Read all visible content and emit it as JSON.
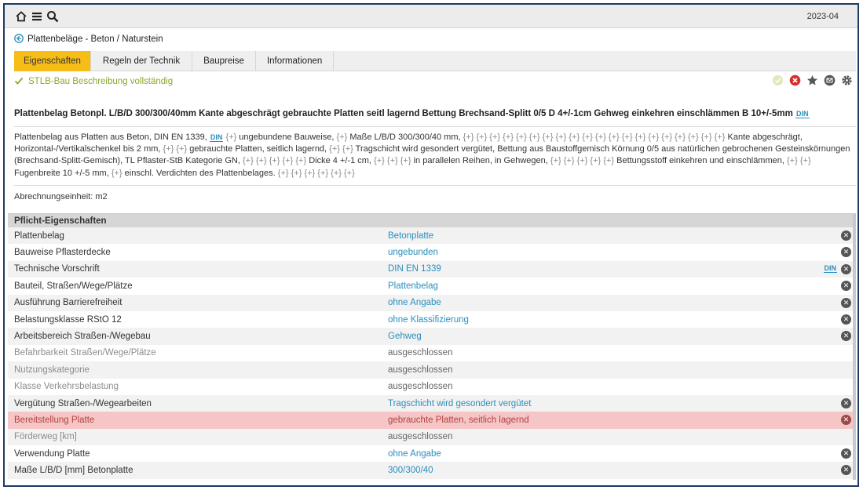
{
  "topbar": {
    "date": "2023-04",
    "icons": [
      "home-icon",
      "menu-icon",
      "search-icon"
    ]
  },
  "breadcrumb": {
    "label": "Plattenbeläge - Beton / Naturstein"
  },
  "tabs": [
    {
      "label": "Eigenschaften",
      "active": true
    },
    {
      "label": "Regeln der Technik",
      "active": false
    },
    {
      "label": "Baupreise",
      "active": false
    },
    {
      "label": "Informationen",
      "active": false
    }
  ],
  "status": {
    "text": "STLB-Bau Beschreibung vollständig",
    "color": "#8aa92a"
  },
  "actions": [
    "check-circle-icon",
    "close-circle-icon",
    "star-icon",
    "mail-icon",
    "gear-icon"
  ],
  "short_title": "Plattenbelag Betonpl. L/B/D 300/300/40mm Kante abgeschrägt gebrauchte Platten seitl lagernd Bettung Brechsand-Splitt 0/5 D 4+/-1cm Gehweg einkehren einschlämmen B 10+/-5mm",
  "din_badge": "DIN",
  "long_text": {
    "p1": "Plattenbelag aus Platten aus Beton, DIN EN 1339,",
    "p2": "ungebundene Bauweise,",
    "p3": "Maße L/B/D 300/300/40 mm,",
    "p4": "Kante abgeschrägt, Horizontal-/Vertikalschenkel bis 2 mm,",
    "p5": "gebrauchte Platten, seitlich lagernd,",
    "p6": "Tragschicht wird gesondert vergütet, Bettung aus Baustoffgemisch Körnung 0/5 aus natürlichen gebrochenen Gesteinskörnungen (Brechsand-Splitt-Gemisch), TL Pflaster-StB Kategorie GN,",
    "p7": "Dicke 4 +/-1 cm,",
    "p8": "in parallelen Reihen, in Gehwegen,",
    "p9": "Bettungsstoff einkehren und einschlämmen,",
    "p10": "Fugenbreite 10 +/-5 mm,",
    "p11": "einschl. Verdichten des Plattenbelages.",
    "plus": "{+}"
  },
  "unit": "Abrechnungseinheit: m2",
  "table": {
    "header": "Pflicht-Eigenschaften",
    "rows": [
      {
        "label": "Plattenbelag",
        "value": "Betonplatte",
        "state": "normal",
        "din": ""
      },
      {
        "label": "Bauweise Pflasterdecke",
        "value": "ungebunden",
        "state": "normal",
        "din": ""
      },
      {
        "label": "Technische Vorschrift",
        "value": "DIN EN 1339",
        "state": "normal",
        "din": "DIN"
      },
      {
        "label": "Bauteil, Straßen/Wege/Plätze",
        "value": "Plattenbelag",
        "state": "normal",
        "din": ""
      },
      {
        "label": "Ausführung Barrierefreiheit",
        "value": "ohne Angabe",
        "state": "normal",
        "din": ""
      },
      {
        "label": "Belastungsklasse RStO 12",
        "value": "ohne Klassifizierung",
        "state": "normal",
        "din": ""
      },
      {
        "label": "Arbeitsbereich Straßen-/Wegebau",
        "value": "Gehweg",
        "state": "normal",
        "din": ""
      },
      {
        "label": "Befahrbarkeit Straßen/Wege/Plätze",
        "value": "ausgeschlossen",
        "state": "dim",
        "din": ""
      },
      {
        "label": "Nutzungskategorie",
        "value": "ausgeschlossen",
        "state": "dim",
        "din": ""
      },
      {
        "label": "Klasse Verkehrsbelastung",
        "value": "ausgeschlossen",
        "state": "dim",
        "din": ""
      },
      {
        "label": "Vergütung Straßen-/Wegearbeiten",
        "value": "Tragschicht wird gesondert vergütet",
        "state": "normal",
        "din": ""
      },
      {
        "label": "Bereitstellung Platte",
        "value": "gebrauchte Platten, seitlich lagernd",
        "state": "hl",
        "din": ""
      },
      {
        "label": "Förderweg [km]",
        "value": "ausgeschlossen",
        "state": "dim",
        "din": ""
      },
      {
        "label": "Verwendung Platte",
        "value": "ohne Angabe",
        "state": "normal",
        "din": ""
      },
      {
        "label": "Maße L/B/D [mm] Betonplatte",
        "value": "300/300/40",
        "state": "normal",
        "din": ""
      }
    ]
  }
}
